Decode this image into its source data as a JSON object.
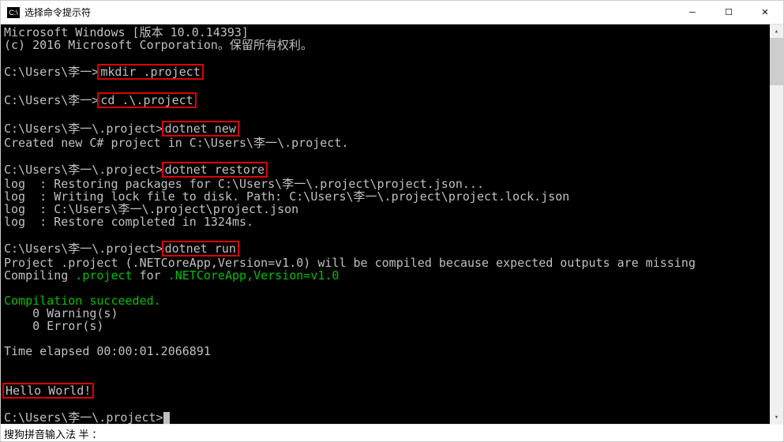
{
  "titlebar": {
    "icon_text": "C:\\",
    "title": "选择命令提示符"
  },
  "lines": {
    "l1": "Microsoft Windows [版本 10.0.14393]",
    "l2": "(c) 2016 Microsoft Corporation。保留所有权利。",
    "p1_prompt": "C:\\Users\\李一>",
    "p1_cmd": "mkdir .project",
    "p2_prompt": "C:\\Users\\李一>",
    "p2_cmd": "cd .\\.project",
    "p3_prompt": "C:\\Users\\李一\\.project>",
    "p3_cmd": "dotnet new",
    "l_created": "Created new C# project in C:\\Users\\李一\\.project.",
    "p4_prompt": "C:\\Users\\李一\\.project>",
    "p4_cmd": "dotnet restore",
    "log1": "log  : Restoring packages for C:\\Users\\李一\\.project\\project.json...",
    "log2": "log  : Writing lock file to disk. Path: C:\\Users\\李一\\.project\\project.lock.json",
    "log3": "log  : C:\\Users\\李一\\.project\\project.json",
    "log4": "log  : Restore completed in 1324ms.",
    "p5_prompt": "C:\\Users\\李一\\.project>",
    "p5_cmd": "dotnet run",
    "run1a": "Project .project (.NETCoreApp,Version=v1.0) will be compiled because expected outputs are missing",
    "run2_a": "Compiling ",
    "run2_b": ".project",
    "run2_c": " for ",
    "run2_d": ".NETCoreApp,Version=v1.0",
    "comp_ok": "Compilation succeeded.",
    "warn": "    0 Warning(s)",
    "err": "    0 Error(s)",
    "elapsed": "Time elapsed 00:00:01.2066891",
    "hello": "Hello World!",
    "p6_prompt": "C:\\Users\\李一\\.project>"
  },
  "ime": "搜狗拼音输入法 半 ："
}
